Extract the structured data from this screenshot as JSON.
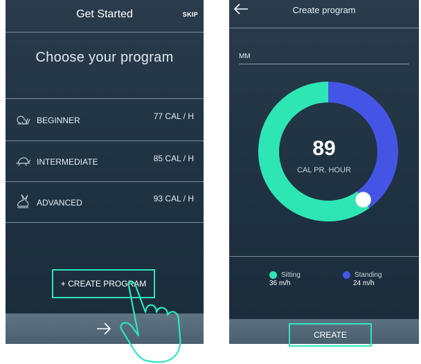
{
  "left_screen": {
    "header": {
      "title": "Get Started",
      "skip_label": "SKIP"
    },
    "heading": "Choose your program",
    "programs": [
      {
        "name": "BEGINNER",
        "calories": "77 CAL / H",
        "icon": "snail-icon"
      },
      {
        "name": "INTERMEDIATE",
        "calories": "85 CAL / H",
        "icon": "turtle-icon"
      },
      {
        "name": "ADVANCED",
        "calories": "93 CAL / H",
        "icon": "rabbit-icon"
      }
    ],
    "create_button_label": "+ CREATE PROGRAM",
    "next_icon": "arrow-right-icon"
  },
  "right_screen": {
    "header": {
      "title": "Create program",
      "back_icon": "arrow-left-icon"
    },
    "name_field": {
      "value": "MM"
    },
    "gauge": {
      "value": "89",
      "label": "CAL PR. HOUR",
      "sitting_fraction": 0.6,
      "standing_fraction": 0.4
    },
    "legend": [
      {
        "name": "Sitting",
        "value": "36 m/h",
        "color": "#2ee6b4"
      },
      {
        "name": "Standing",
        "value": "24 m/h",
        "color": "#4455e6"
      }
    ],
    "create_button_label": "CREATE"
  },
  "colors": {
    "accent": "#2ee6c1",
    "sitting": "#2ee6b4",
    "standing": "#4455e6",
    "panel": "#213444"
  }
}
